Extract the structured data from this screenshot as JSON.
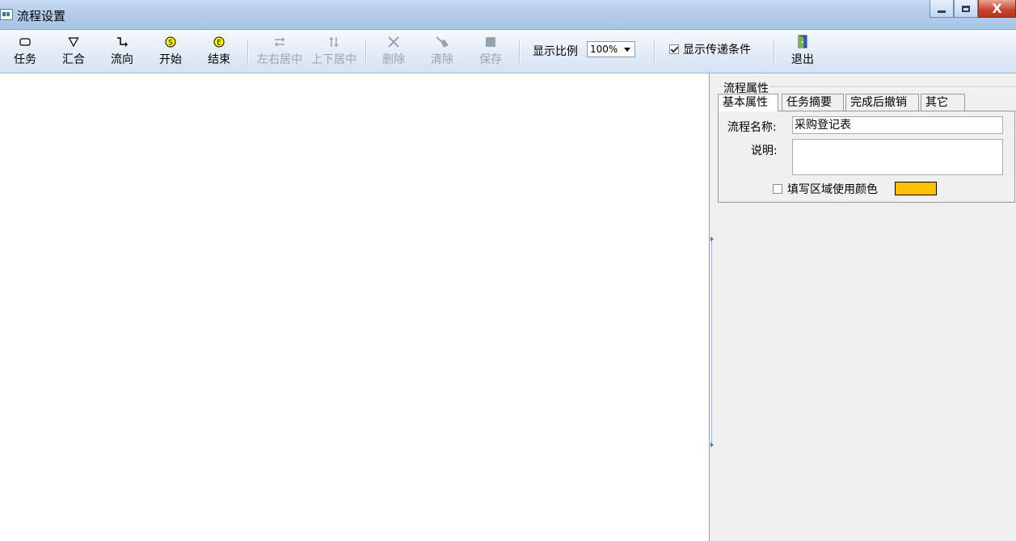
{
  "window": {
    "title": "流程设置",
    "close_glyph": "X"
  },
  "toolbar": {
    "task": "任务",
    "merge": "汇合",
    "flow": "流向",
    "start": "开始",
    "start_badge": "S",
    "end": "结束",
    "end_badge": "E",
    "center_horizontal": "左右居中",
    "center_vertical": "上下居中",
    "delete": "删除",
    "clear": "清除",
    "save": "保存",
    "zoom_label": "显示比例",
    "zoom_value": "100%",
    "show_conditions": "显示传递条件",
    "show_conditions_checked": true,
    "exit": "退出"
  },
  "props": {
    "group_title": "流程属性",
    "tabs": [
      "基本属性",
      "任务摘要",
      "完成后撤销",
      "其它"
    ],
    "active_tab": 0,
    "name_label": "流程名称:",
    "name_value": "采购登记表",
    "desc_label": "说明:",
    "desc_value": "",
    "fill_color_label": "填写区域使用颜色",
    "fill_color_checked": false,
    "fill_color": "#ffc000"
  },
  "colors": {
    "badge_yellow": "#ffff00"
  }
}
